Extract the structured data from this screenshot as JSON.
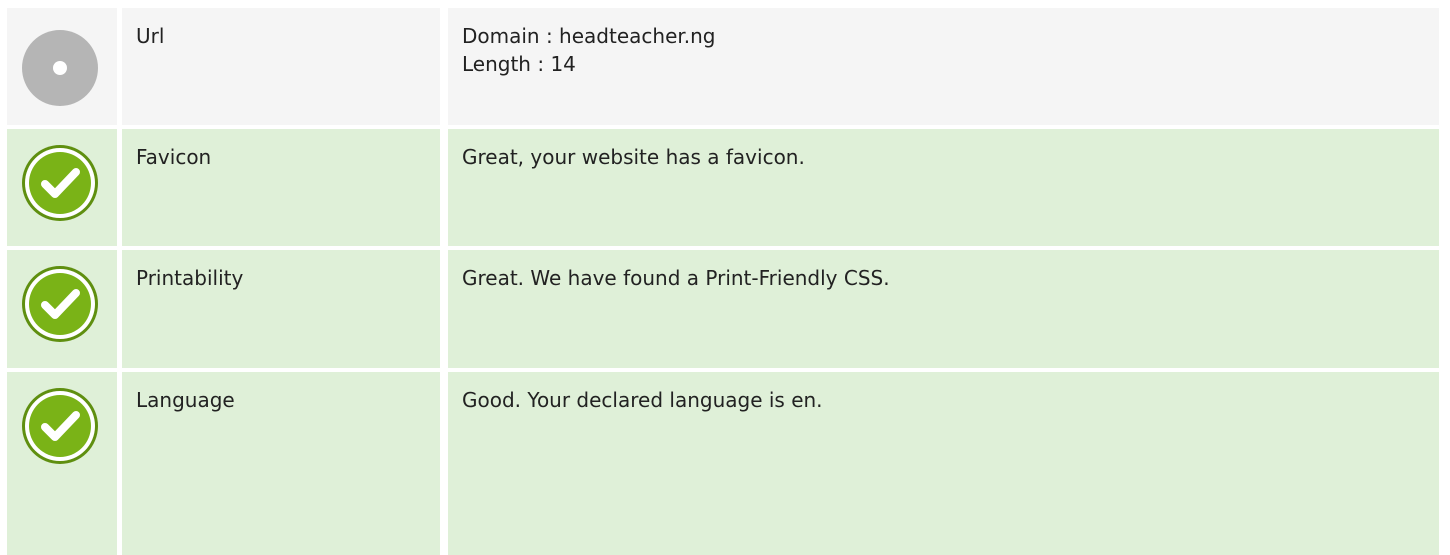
{
  "rows": [
    {
      "status": "neutral",
      "icon": "neutral-circle-icon",
      "label": "Url",
      "lines": [
        "Domain : headteacher.ng",
        "Length : 14"
      ]
    },
    {
      "status": "good",
      "icon": "check-icon",
      "label": "Favicon",
      "lines": [
        "Great, your website has a favicon."
      ]
    },
    {
      "status": "good",
      "icon": "check-icon",
      "label": "Printability",
      "lines": [
        "Great. We have found a Print-Friendly CSS."
      ]
    },
    {
      "status": "good",
      "icon": "check-icon",
      "label": "Language",
      "lines": [
        "Good. Your declared language is en."
      ]
    }
  ],
  "colors": {
    "neutral_bg": "#f5f5f5",
    "good_bg": "#dff0d8",
    "check_green": "#7ab317",
    "neutral_gray": "#b5b5b5"
  }
}
